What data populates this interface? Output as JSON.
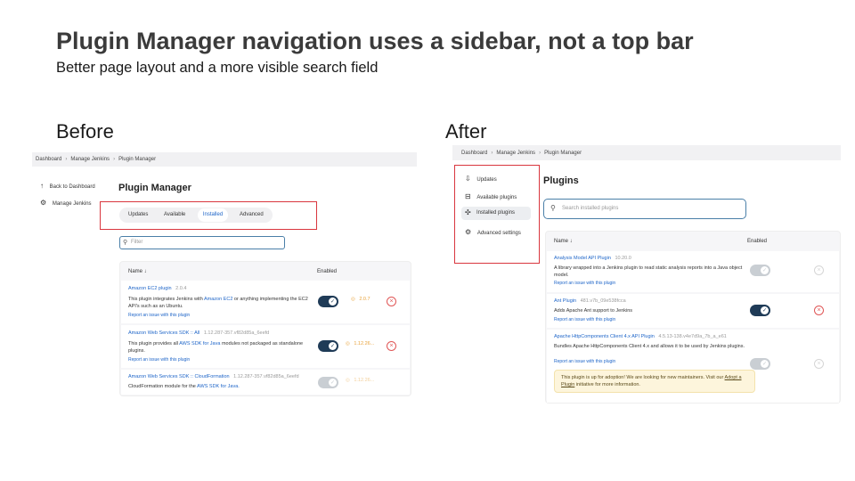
{
  "slide": {
    "title": "Plugin Manager navigation uses a sidebar, not a top bar",
    "subtitle": "Better page layout and a more visible search field"
  },
  "before": {
    "label": "Before",
    "breadcrumbs": [
      "Dashboard",
      "Manage Jenkins",
      "Plugin Manager"
    ],
    "sidebar": [
      {
        "label": "Back to Dashboard",
        "icon": "arrow-up-icon"
      },
      {
        "label": "Manage Jenkins",
        "icon": "gear-icon"
      }
    ],
    "heading": "Plugin Manager",
    "tabs": [
      "Updates",
      "Available",
      "Installed",
      "Advanced"
    ],
    "active_tab": "Installed",
    "filter_placeholder": "Filter",
    "table": {
      "col_name": "Name ↓",
      "col_enabled": "Enabled",
      "rows": [
        {
          "name": "Amazon EC2 plugin",
          "version": "2.0.4",
          "desc_pre": "This plugin integrates Jenkins with ",
          "desc_link": "Amazon EC2",
          "desc_post": " or anything implementing the EC2 API's such as an Ubuntu.",
          "report": "Report an issue with this plugin",
          "update": "2.0.7",
          "enabled": true
        },
        {
          "name": "Amazon Web Services SDK :: All",
          "version": "1.12.287-357.vf82d85a_6eefd",
          "desc_pre": "This plugin provides all ",
          "desc_link": "AWS SDK for Java",
          "desc_post": " modules not packaged as standalone plugins.",
          "report": "Report an issue with this plugin",
          "update": "1.12.26...",
          "enabled": true
        },
        {
          "name": "Amazon Web Services SDK :: CloudFormation",
          "version": "1.12.287-357.vf82d85a_6eefd",
          "desc_pre": "CloudFormation module for the ",
          "desc_link": "AWS SDK for Java.",
          "desc_post": "",
          "report": "",
          "update": "1.12.26...",
          "enabled": false
        }
      ]
    }
  },
  "after": {
    "label": "After",
    "breadcrumbs": [
      "Dashboard",
      "Manage Jenkins",
      "Plugin Manager"
    ],
    "sidebar": [
      {
        "label": "Updates",
        "icon": "download-icon"
      },
      {
        "label": "Available plugins",
        "icon": "shopping-bag-icon"
      },
      {
        "label": "Installed plugins",
        "icon": "puzzle-icon"
      },
      {
        "label": "Advanced settings",
        "icon": "gear-icon"
      }
    ],
    "active_item": "Installed plugins",
    "heading": "Plugins",
    "search_placeholder": "Search installed plugins",
    "table": {
      "col_name": "Name ↓",
      "col_enabled": "Enabled",
      "rows": [
        {
          "name": "Analysis Model API Plugin",
          "version": "10.20.0",
          "desc": "A library wrapped into a Jenkins plugin to read static analysis reports into a Java object model.",
          "report": "Report an issue with this plugin",
          "enabled": false
        },
        {
          "name": "Ant Plugin",
          "version": "481.v7b_09e538fcca",
          "desc": "Adds Apache Ant support to Jenkins",
          "report": "Report an issue with this plugin",
          "enabled": true
        },
        {
          "name": "Apache HttpComponents Client 4.x API Plugin",
          "version": "4.5.13-138.v4e7d9a_7b_a_e61",
          "desc": "Bundles Apache HttpComponents Client 4.x and allows it to be used by Jenkins plugins.",
          "report": "Report an issue with this plugin",
          "enabled": false,
          "notice_pre": "This plugin is up for adoption! We are looking for new maintainers. Visit our ",
          "notice_link": "Adopt a Plugin",
          "notice_post": " initiative for more information."
        }
      ]
    }
  },
  "colors": {
    "highlight_box": "#d9363e",
    "link": "#2167c9",
    "toggle_on": "#1f3b57",
    "toggle_off": "#c9ced3",
    "update_badge": "#e8a23a",
    "notice_bg": "#fdf5dc"
  }
}
